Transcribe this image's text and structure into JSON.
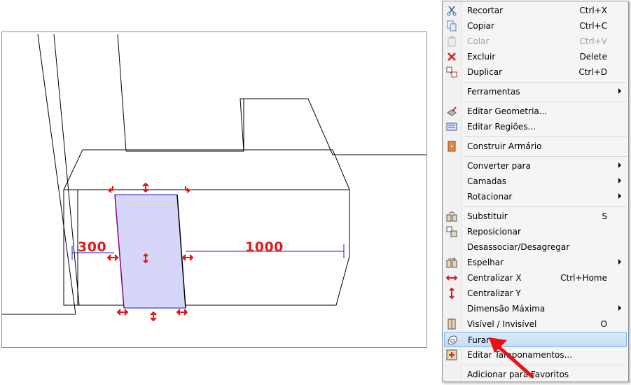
{
  "dimensions": {
    "left_value": "300",
    "right_value": "1000"
  },
  "menu": {
    "items": [
      {
        "label": "Recortar",
        "shortcut": "Ctrl+X",
        "icon": "scissors-icon"
      },
      {
        "label": "Copiar",
        "shortcut": "Ctrl+C",
        "icon": "copy-icon"
      },
      {
        "label": "Colar",
        "shortcut": "Ctrl+V",
        "icon": "paste-icon",
        "disabled": true
      },
      {
        "label": "Excluir",
        "shortcut": "Delete",
        "icon": "delete-x-icon"
      },
      {
        "label": "Duplicar",
        "shortcut": "Ctrl+D",
        "icon": "duplicate-icon"
      },
      {
        "label": "Ferramentas",
        "submenu": true
      },
      {
        "label": "Editar Geometria...",
        "icon": "edit-geometry-icon"
      },
      {
        "label": "Editar Regiões...",
        "icon": "edit-regions-icon"
      },
      {
        "label": "Construir Armário",
        "icon": "cabinet-icon"
      },
      {
        "label": "Converter para",
        "submenu": true
      },
      {
        "label": "Camadas",
        "submenu": true
      },
      {
        "label": "Rotacionar",
        "submenu": true
      },
      {
        "label": "Substituir",
        "shortcut": "S",
        "icon": "replace-icon"
      },
      {
        "label": "Reposicionar",
        "icon": "reposition-icon"
      },
      {
        "label": "Desassociar/Desagregar"
      },
      {
        "label": "Espelhar",
        "submenu": true,
        "icon": "mirror-icon"
      },
      {
        "label": "Centralizar X",
        "shortcut": "Ctrl+Home",
        "icon": "center-x-icon"
      },
      {
        "label": "Centralizar Y",
        "icon": "center-y-icon"
      },
      {
        "label": "Dimensão Máxima",
        "submenu": true
      },
      {
        "label": "Visível / Invisível",
        "shortcut": "O",
        "icon": "visibility-icon"
      },
      {
        "label": "Furar",
        "icon": "drill-icon",
        "highlighted": true
      },
      {
        "label": "Editar Tamponamentos...",
        "icon": "edit-covers-icon"
      },
      {
        "label": "Adicionar para Favoritos"
      }
    ]
  },
  "colors": {
    "accent": "#e01b1b",
    "selection": "#d6d6f8",
    "menu_highlight": "#c4ddf6"
  }
}
